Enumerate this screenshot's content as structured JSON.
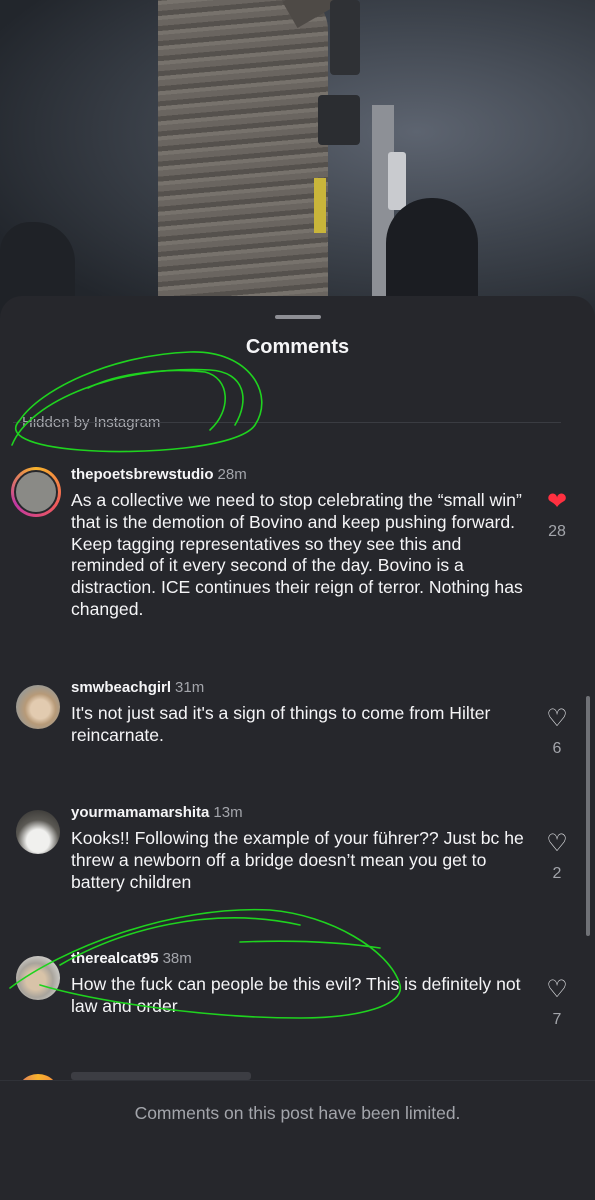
{
  "sheet": {
    "title": "Comments",
    "hidden_label": "Hidden by Instagram",
    "footer_text": "Comments on this post have been limited."
  },
  "comments": [
    {
      "username": "thepoetsbrewstudio",
      "time": "28m",
      "text": "As a collective we need to stop celebrating the “small win” that is the demotion of Bovino and keep pushing forward. Keep tagging representatives so they see this and reminded of it every second of the day. Bovino is a distraction. ICE continues their reign of terror. Nothing has changed.",
      "likes": "28",
      "liked": true
    },
    {
      "username": "smwbeachgirl",
      "time": "31m",
      "text": "It's not just sad it's a sign of things to come from Hilter reincarnate.",
      "likes": "6",
      "liked": false
    },
    {
      "username": "yourmamamarshita",
      "time": "13m",
      "text": "Kooks!! Following the example of your führer?? Just bc he threw a newborn off a bridge doesn’t mean you get to battery children",
      "likes": "2",
      "liked": false
    },
    {
      "username": "therealcat95",
      "time": "38m",
      "text": "How the fuck can people be this evil?  This is definitely not law and order",
      "likes": "7",
      "liked": false
    }
  ],
  "icons": {
    "like": "heart-icon",
    "liked": "heart-filled-icon"
  },
  "colors": {
    "liked_heart": "#ff3040",
    "annotation": "#1fd31f"
  }
}
